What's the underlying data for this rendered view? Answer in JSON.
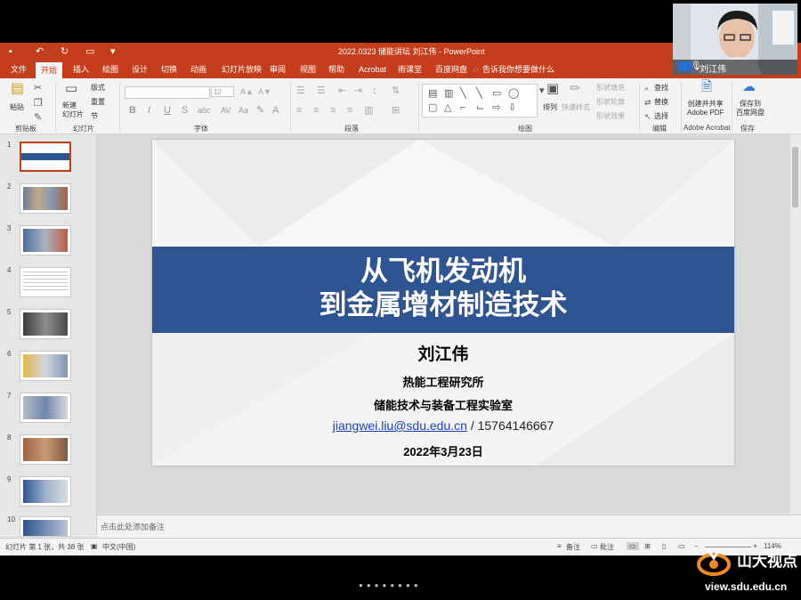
{
  "window": {
    "title": "2022.0323 储能讲坛 刘江伟 - PowerPoint"
  },
  "menu_tabs": [
    "文件",
    "开始",
    "插入",
    "绘图",
    "设计",
    "切换",
    "动画",
    "幻灯片放映",
    "审阅",
    "视图",
    "帮助",
    "Acrobat",
    "雨课堂",
    "百度网盘"
  ],
  "tell_me": "告诉我你想要做什么",
  "ribbon": {
    "groups": [
      "剪贴板",
      "幻灯片",
      "字体",
      "段落",
      "绘图",
      "编辑",
      "Adobe Acrobat",
      "保存"
    ],
    "paste": "粘贴",
    "new_slide": "新建\n幻灯片",
    "layout": "版式",
    "reset": "重置",
    "section": "节",
    "font_size": "12",
    "arrange": "排列",
    "quick_styles": "快速样式",
    "shape_fill": "形状填充",
    "shape_outline": "形状轮廓",
    "shape_effects": "形状效果",
    "find": "查找",
    "replace": "替换",
    "select": "选择",
    "create_pdf": "创建并共享\nAdobe PDF",
    "save_baidu": "保存到\n百度网盘"
  },
  "thumbnails": [
    "1",
    "2",
    "3",
    "4",
    "5",
    "6",
    "7",
    "8",
    "9",
    "10"
  ],
  "slide": {
    "title_line1": "从飞机发动机",
    "title_line2": "到金属增材制造技术",
    "presenter": "刘江伟",
    "institute": "热能工程研究所",
    "lab": "储能技术与装备工程实验室",
    "email": "jiangwei.liu@sdu.edu.cn",
    "phone": " / 15764146667",
    "date": "2022年3月23日"
  },
  "notes_placeholder": "点击此处添加备注",
  "status": {
    "slide_info": "幻灯片 第 1 张，共 38 张",
    "language": "中文(中国)",
    "notes": "备注",
    "comments": "批注",
    "zoom": "114%"
  },
  "webcam": {
    "name": "刘江伟"
  },
  "watermark": {
    "text": "山大视点",
    "url": "view.sdu.edu.cn"
  },
  "colors": {
    "brand": "#c43e1c",
    "banner": "#2e5591",
    "link": "#1a43b4"
  }
}
